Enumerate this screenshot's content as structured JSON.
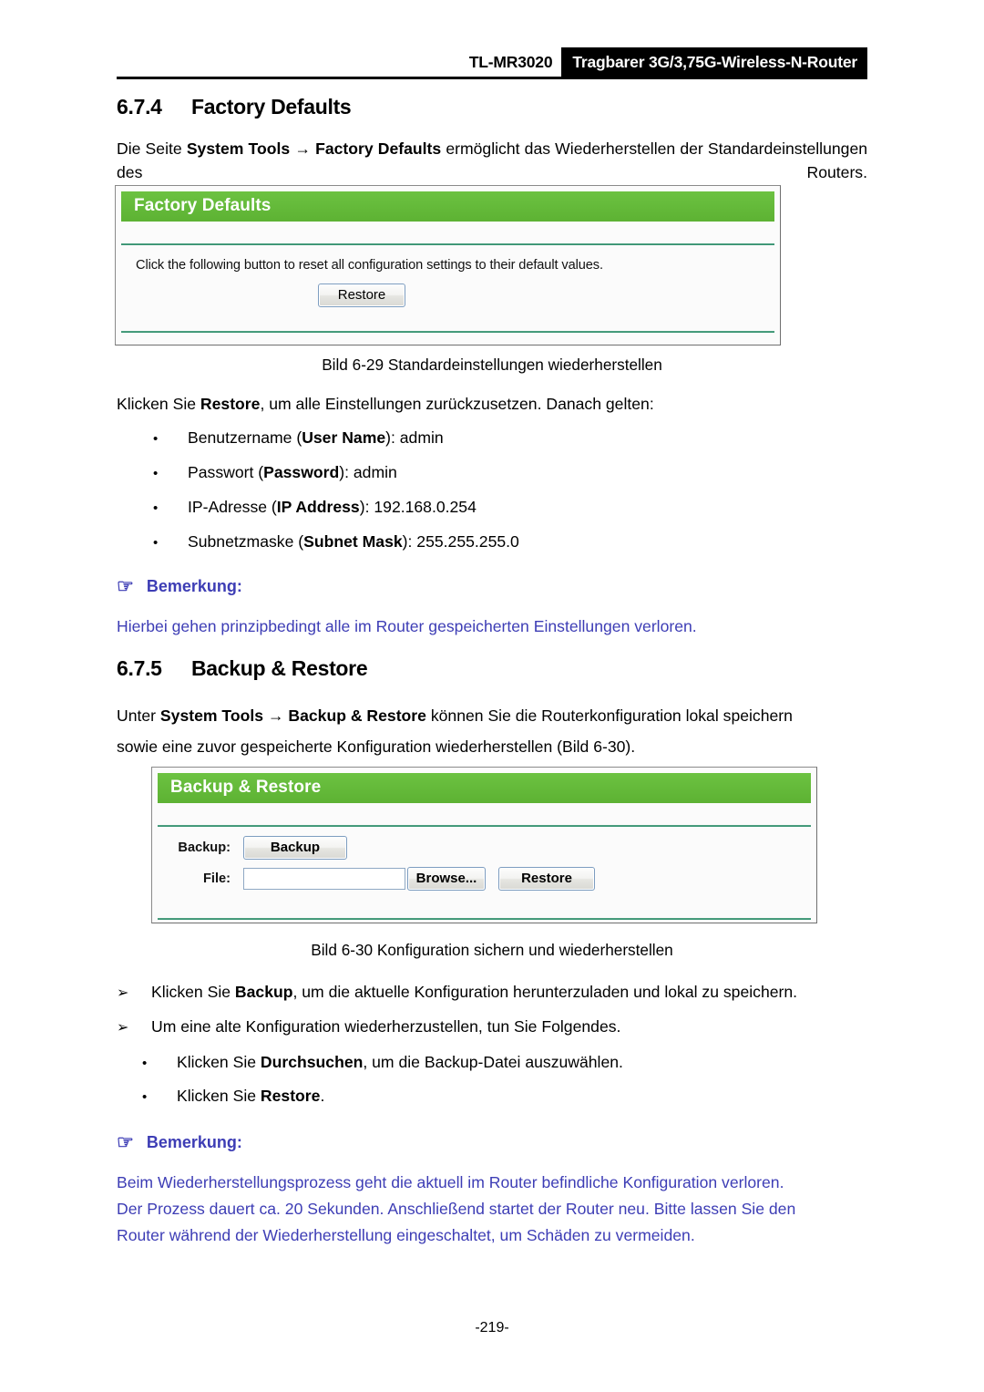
{
  "header": {
    "model": "TL-MR3020",
    "product": "Tragbarer 3G/3,75G-Wireless-N-Router"
  },
  "sections": {
    "factory_defaults": {
      "number": "6.7.4",
      "title": "Factory Defaults",
      "intro_1": "Die Seite ",
      "intro_b1": "System Tools",
      "intro_2": " → ",
      "intro_b2": "Factory Defaults",
      "intro_3": " ermöglicht das Wiederherstellen der Standardeinstellungen des Routers.",
      "caption": "Bild 6-29 Standardeinstellungen wiederherstellen",
      "after_1": "Klicken Sie ",
      "after_b": "Restore",
      "after_2": ", um alle Einstellungen zurückzusetzen. Danach gelten:",
      "bullets": [
        {
          "mark": "•",
          "pre": "Benutzername (",
          "bold": "User Name",
          "post": "): admin"
        },
        {
          "mark": "•",
          "pre": "Passwort (",
          "bold": "Password",
          "post": "): admin"
        },
        {
          "mark": "•",
          "pre": "IP-Adresse (",
          "bold": "IP Address",
          "post": "): 192.168.0.254"
        },
        {
          "mark": "•",
          "pre": "Subnetzmaske (",
          "bold": "Subnet Mask",
          "post": "): 255.255.255.0"
        }
      ],
      "note": {
        "icon": "☞",
        "label": "Bemerkung:",
        "text": "Hierbei gehen prinzipbedingt alle im Router gespeicherten Einstellungen verloren."
      }
    },
    "backup_restore": {
      "number": "6.7.5",
      "title": "Backup & Restore",
      "intro_1": "Unter ",
      "intro_b1": "System Tools",
      "intro_2": " → ",
      "intro_b2": "Backup & Restore",
      "intro_3": " können Sie die Routerkonfiguration lokal speichern",
      "intro_line2": "sowie eine zuvor gespeicherte Konfiguration wiederherstellen (Bild 6-30).",
      "caption": "Bild 6-30 Konfiguration sichern und wiederherstellen",
      "arrow_items": [
        {
          "mark": "➢",
          "pre": "Klicken Sie ",
          "bold": "Backup",
          "post": ", um die aktuelle Konfiguration herunterzuladen und lokal zu speichern."
        },
        {
          "mark": "➢",
          "pre": "Um eine alte Konfiguration wiederherzustellen, tun Sie Folgendes.",
          "bold": "",
          "post": ""
        }
      ],
      "sub_items": [
        {
          "mark": "•",
          "pre": "Klicken Sie ",
          "bold": "Durchsuchen",
          "post": ", um die Backup-Datei auszuwählen."
        },
        {
          "mark": "•",
          "pre": "Klicken Sie ",
          "bold": "Restore",
          "post": "."
        }
      ],
      "note": {
        "icon": "☞",
        "label": "Bemerkung:",
        "line1": "Beim Wiederherstellungsprozess geht die aktuell im Router befindliche Konfiguration verloren.",
        "line2": "Der Prozess dauert ca. 20 Sekunden. Anschließend startet der Router neu. Bitte lassen Sie den",
        "line3": "Router während der Wiederherstellung eingeschaltet, um Schäden zu vermeiden."
      }
    }
  },
  "screenshot_factory_defaults": {
    "panel_title": "Factory Defaults",
    "description": "Click the following button to reset all configuration settings to their default values.",
    "restore_button": "Restore"
  },
  "screenshot_backup_restore": {
    "panel_title": "Backup & Restore",
    "backup_label": "Backup:",
    "backup_button": "Backup",
    "file_label": "File:",
    "file_value": "",
    "browse_button": "Browse...",
    "restore_button": "Restore"
  },
  "footer": {
    "page_number": "-219-"
  },
  "colors": {
    "panel_green": "#63bb38",
    "note_blue": "#3d3db5",
    "banner_black": "#000000"
  }
}
